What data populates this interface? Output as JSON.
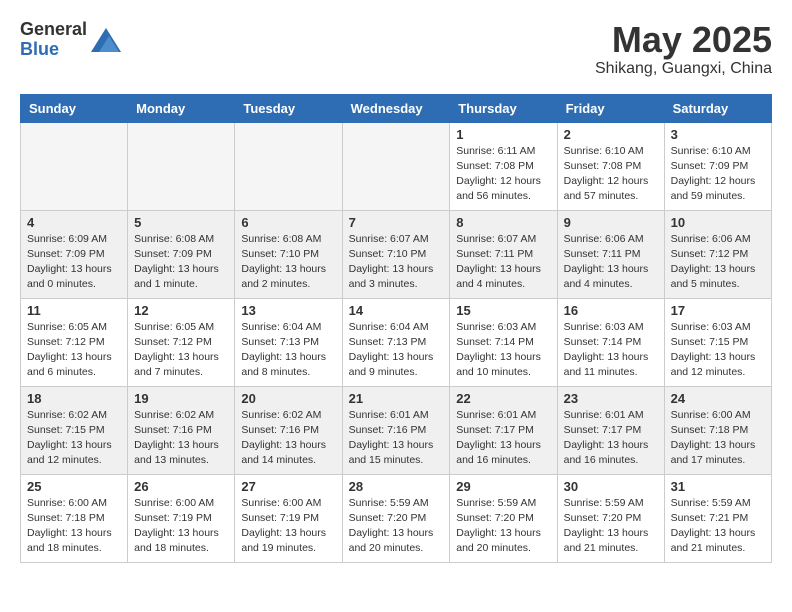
{
  "header": {
    "logo_general": "General",
    "logo_blue": "Blue",
    "month": "May 2025",
    "location": "Shikang, Guangxi, China"
  },
  "weekdays": [
    "Sunday",
    "Monday",
    "Tuesday",
    "Wednesday",
    "Thursday",
    "Friday",
    "Saturday"
  ],
  "weeks": [
    [
      {
        "day": "",
        "empty": true
      },
      {
        "day": "",
        "empty": true
      },
      {
        "day": "",
        "empty": true
      },
      {
        "day": "",
        "empty": true
      },
      {
        "day": "1",
        "sunrise": "6:11 AM",
        "sunset": "7:08 PM",
        "daylight": "12 hours and 56 minutes."
      },
      {
        "day": "2",
        "sunrise": "6:10 AM",
        "sunset": "7:08 PM",
        "daylight": "12 hours and 57 minutes."
      },
      {
        "day": "3",
        "sunrise": "6:10 AM",
        "sunset": "7:09 PM",
        "daylight": "12 hours and 59 minutes."
      }
    ],
    [
      {
        "day": "4",
        "sunrise": "6:09 AM",
        "sunset": "7:09 PM",
        "daylight": "13 hours and 0 minutes."
      },
      {
        "day": "5",
        "sunrise": "6:08 AM",
        "sunset": "7:09 PM",
        "daylight": "13 hours and 1 minute."
      },
      {
        "day": "6",
        "sunrise": "6:08 AM",
        "sunset": "7:10 PM",
        "daylight": "13 hours and 2 minutes."
      },
      {
        "day": "7",
        "sunrise": "6:07 AM",
        "sunset": "7:10 PM",
        "daylight": "13 hours and 3 minutes."
      },
      {
        "day": "8",
        "sunrise": "6:07 AM",
        "sunset": "7:11 PM",
        "daylight": "13 hours and 4 minutes."
      },
      {
        "day": "9",
        "sunrise": "6:06 AM",
        "sunset": "7:11 PM",
        "daylight": "13 hours and 4 minutes."
      },
      {
        "day": "10",
        "sunrise": "6:06 AM",
        "sunset": "7:12 PM",
        "daylight": "13 hours and 5 minutes."
      }
    ],
    [
      {
        "day": "11",
        "sunrise": "6:05 AM",
        "sunset": "7:12 PM",
        "daylight": "13 hours and 6 minutes."
      },
      {
        "day": "12",
        "sunrise": "6:05 AM",
        "sunset": "7:12 PM",
        "daylight": "13 hours and 7 minutes."
      },
      {
        "day": "13",
        "sunrise": "6:04 AM",
        "sunset": "7:13 PM",
        "daylight": "13 hours and 8 minutes."
      },
      {
        "day": "14",
        "sunrise": "6:04 AM",
        "sunset": "7:13 PM",
        "daylight": "13 hours and 9 minutes."
      },
      {
        "day": "15",
        "sunrise": "6:03 AM",
        "sunset": "7:14 PM",
        "daylight": "13 hours and 10 minutes."
      },
      {
        "day": "16",
        "sunrise": "6:03 AM",
        "sunset": "7:14 PM",
        "daylight": "13 hours and 11 minutes."
      },
      {
        "day": "17",
        "sunrise": "6:03 AM",
        "sunset": "7:15 PM",
        "daylight": "13 hours and 12 minutes."
      }
    ],
    [
      {
        "day": "18",
        "sunrise": "6:02 AM",
        "sunset": "7:15 PM",
        "daylight": "13 hours and 12 minutes."
      },
      {
        "day": "19",
        "sunrise": "6:02 AM",
        "sunset": "7:16 PM",
        "daylight": "13 hours and 13 minutes."
      },
      {
        "day": "20",
        "sunrise": "6:02 AM",
        "sunset": "7:16 PM",
        "daylight": "13 hours and 14 minutes."
      },
      {
        "day": "21",
        "sunrise": "6:01 AM",
        "sunset": "7:16 PM",
        "daylight": "13 hours and 15 minutes."
      },
      {
        "day": "22",
        "sunrise": "6:01 AM",
        "sunset": "7:17 PM",
        "daylight": "13 hours and 16 minutes."
      },
      {
        "day": "23",
        "sunrise": "6:01 AM",
        "sunset": "7:17 PM",
        "daylight": "13 hours and 16 minutes."
      },
      {
        "day": "24",
        "sunrise": "6:00 AM",
        "sunset": "7:18 PM",
        "daylight": "13 hours and 17 minutes."
      }
    ],
    [
      {
        "day": "25",
        "sunrise": "6:00 AM",
        "sunset": "7:18 PM",
        "daylight": "13 hours and 18 minutes."
      },
      {
        "day": "26",
        "sunrise": "6:00 AM",
        "sunset": "7:19 PM",
        "daylight": "13 hours and 18 minutes."
      },
      {
        "day": "27",
        "sunrise": "6:00 AM",
        "sunset": "7:19 PM",
        "daylight": "13 hours and 19 minutes."
      },
      {
        "day": "28",
        "sunrise": "5:59 AM",
        "sunset": "7:20 PM",
        "daylight": "13 hours and 20 minutes."
      },
      {
        "day": "29",
        "sunrise": "5:59 AM",
        "sunset": "7:20 PM",
        "daylight": "13 hours and 20 minutes."
      },
      {
        "day": "30",
        "sunrise": "5:59 AM",
        "sunset": "7:20 PM",
        "daylight": "13 hours and 21 minutes."
      },
      {
        "day": "31",
        "sunrise": "5:59 AM",
        "sunset": "7:21 PM",
        "daylight": "13 hours and 21 minutes."
      }
    ]
  ]
}
